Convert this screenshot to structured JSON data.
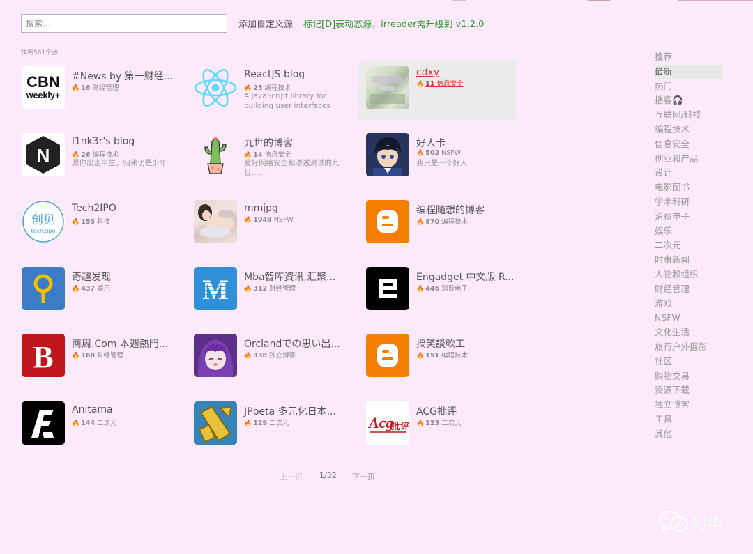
{
  "search": {
    "placeholder": "搜索..."
  },
  "header": {
    "add_custom": "添加自定义源",
    "notice": "标记[D]表动态源，irreader需升级到 v1.2.0"
  },
  "result_count": "找到561个源",
  "cards": [
    {
      "title": "#News by 第一财经...",
      "count": "16",
      "category": "财经管理",
      "desc": "",
      "icon": "cbn-weekly-logo"
    },
    {
      "title": "ReactJS blog",
      "count": "25",
      "category": "编程技术",
      "desc": "A JavaScript library for building user interfaces",
      "icon": "react-atom-logo"
    },
    {
      "title": "cdxy",
      "count": "11",
      "category": "信息安全",
      "desc": "",
      "icon": "blurred-avatar"
    },
    {
      "title": "l1nk3r's blog",
      "count": "26",
      "category": "编程技术",
      "desc": "愿你出走半生，归来仍是少年",
      "icon": "letter-n-hexagon-logo"
    },
    {
      "title": "九世的博客",
      "count": "14",
      "category": "信息安全",
      "desc": "爱好网络安全和渗透测试的九世......",
      "icon": "cactus-icon"
    },
    {
      "title": "好人卡",
      "count": "502",
      "category": "NSFW",
      "desc": "我只是一个好人",
      "icon": "anime-detective-avatar"
    },
    {
      "title": "Tech2IPO",
      "count": "153",
      "category": "科技",
      "desc": "",
      "icon": "tech2ipo-logo"
    },
    {
      "title": "mmjpg",
      "count": "1049",
      "category": "NSFW",
      "desc": "",
      "icon": "photo-thumbnail"
    },
    {
      "title": "编程随想的博客",
      "count": "870",
      "category": "编程技术",
      "desc": "",
      "icon": "blogger-logo"
    },
    {
      "title": "奇趣发现",
      "count": "437",
      "category": "娱乐",
      "desc": "",
      "icon": "key-hole-logo"
    },
    {
      "title": "Mba智库资讯,汇聚...",
      "count": "312",
      "category": "财经管理",
      "desc": "",
      "icon": "mba-m-logo"
    },
    {
      "title": "Engadget 中文版 R...",
      "count": "446",
      "category": "消费电子",
      "desc": "",
      "icon": "engadget-e-logo"
    },
    {
      "title": "商周.Com 本週熱門...",
      "count": "168",
      "category": "财经管理",
      "desc": "",
      "icon": "letter-b-logo"
    },
    {
      "title": "Orclandでの思い出...",
      "count": "338",
      "category": "独立博客",
      "desc": "",
      "icon": "anime-girl-avatar"
    },
    {
      "title": "搞笑談軟工",
      "count": "151",
      "category": "编程技术",
      "desc": "",
      "icon": "blogger-logo"
    },
    {
      "title": "Anitama",
      "count": "144",
      "category": "二次元",
      "desc": "",
      "icon": "anitama-logo"
    },
    {
      "title": "JPbeta 多元化日本...",
      "count": "129",
      "category": "二次元",
      "desc": "",
      "icon": "jpbeta-logo"
    },
    {
      "title": "ACG批评",
      "count": "123",
      "category": "二次元",
      "desc": "",
      "icon": "acg-critique-logo"
    }
  ],
  "sidebar": {
    "items": [
      "推荐",
      "最新",
      "热门",
      "播客🎧",
      "互联网/科技",
      "编程技术",
      "信息安全",
      "创业和产品",
      "设计",
      "电影图书",
      "学术科研",
      "消费电子",
      "娱乐",
      "二次元",
      "时事新闻",
      "人物和组织",
      "财经管理",
      "游戏",
      "NSFW",
      "文化生活",
      "旅行户外摄影",
      "社区",
      "购物交易",
      "资源下载",
      "独立博客",
      "工具",
      "其他"
    ],
    "active_index": 1
  },
  "pagination": {
    "prev": "上一页",
    "page": "1/32",
    "next": "下一页"
  },
  "watermark": {
    "text": "幻华"
  }
}
